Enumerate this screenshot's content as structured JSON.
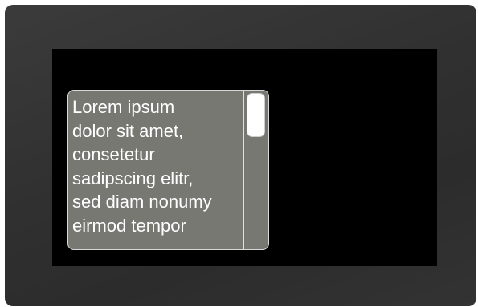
{
  "textbox": {
    "text": "Lorem ipsum\ndolor sit amet,\nconsetetur\nsadipscing elitr,\nsed diam nonumy\neirmod tempor"
  },
  "colors": {
    "device_bezel": "#333333",
    "screen": "#000000",
    "textbox_background": "#777872",
    "text": "#ffffff",
    "scroll_thumb": "#ffffff"
  }
}
